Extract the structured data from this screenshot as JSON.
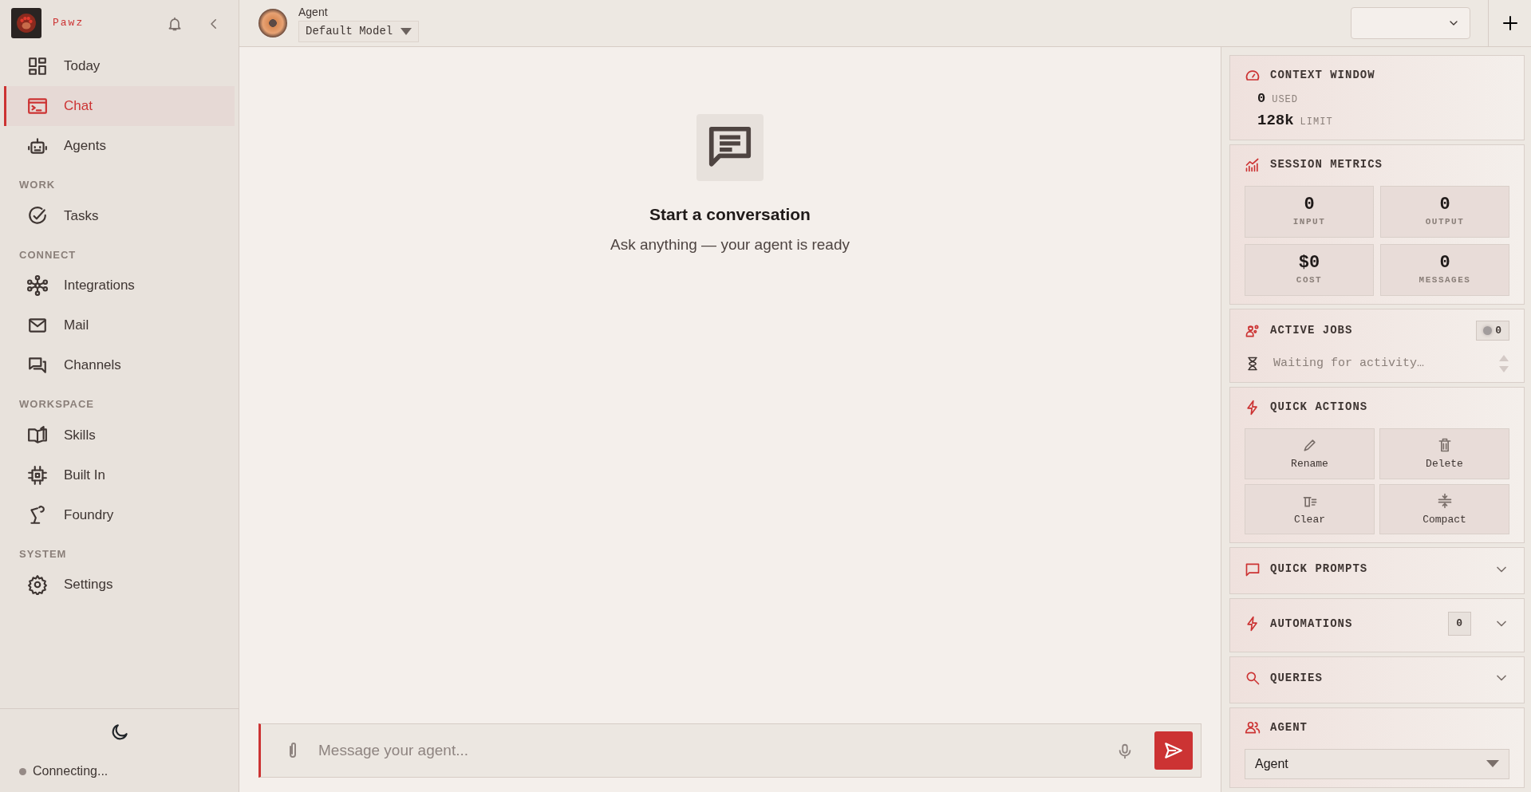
{
  "sidebar": {
    "brand": "Pawz",
    "sections": [
      {
        "items": [
          {
            "label": "Today",
            "selected": false
          },
          {
            "label": "Chat",
            "selected": true
          },
          {
            "label": "Agents",
            "selected": false
          }
        ]
      },
      {
        "label": "WORK",
        "items": [
          {
            "label": "Tasks",
            "selected": false
          }
        ]
      },
      {
        "label": "CONNECT",
        "items": [
          {
            "label": "Integrations",
            "selected": false
          },
          {
            "label": "Mail",
            "selected": false
          },
          {
            "label": "Channels",
            "selected": false
          }
        ]
      },
      {
        "label": "WORKSPACE",
        "items": [
          {
            "label": "Skills",
            "selected": false
          },
          {
            "label": "Built In",
            "selected": false
          },
          {
            "label": "Foundry",
            "selected": false
          }
        ]
      },
      {
        "label": "SYSTEM",
        "items": [
          {
            "label": "Settings",
            "selected": false
          }
        ]
      }
    ],
    "status": "Connecting..."
  },
  "header": {
    "agent_name": "Agent",
    "model": "Default Model"
  },
  "empty_state": {
    "title": "Start a conversation",
    "subtitle": "Ask anything — your agent is ready"
  },
  "composer": {
    "placeholder": "Message your agent..."
  },
  "panels": [
    {
      "kind": "context",
      "title": "CONTEXT WINDOW",
      "rows": [
        {
          "value": "0",
          "label": "USED"
        },
        {
          "value": "128k",
          "label": "LIMIT"
        }
      ]
    },
    {
      "kind": "metrics",
      "title": "SESSION METRICS",
      "metrics": [
        {
          "value": "0",
          "label": "INPUT"
        },
        {
          "value": "0",
          "label": "OUTPUT"
        },
        {
          "value": "$0",
          "label": "COST"
        },
        {
          "value": "0",
          "label": "MESSAGES"
        }
      ]
    },
    {
      "kind": "jobs",
      "title": "ACTIVE JOBS",
      "count": "0",
      "status": "Waiting for activity…"
    },
    {
      "kind": "actions",
      "title": "QUICK ACTIONS",
      "actions": [
        "Rename",
        "Delete",
        "Clear",
        "Compact"
      ]
    },
    {
      "kind": "collapsible",
      "title": "QUICK PROMPTS",
      "expanded": false
    },
    {
      "kind": "collapsible",
      "title": "AUTOMATIONS",
      "count": "0",
      "expanded": false
    },
    {
      "kind": "collapsible",
      "title": "QUERIES",
      "expanded": false
    },
    {
      "kind": "select",
      "title": "AGENT",
      "value": "Agent"
    }
  ]
}
